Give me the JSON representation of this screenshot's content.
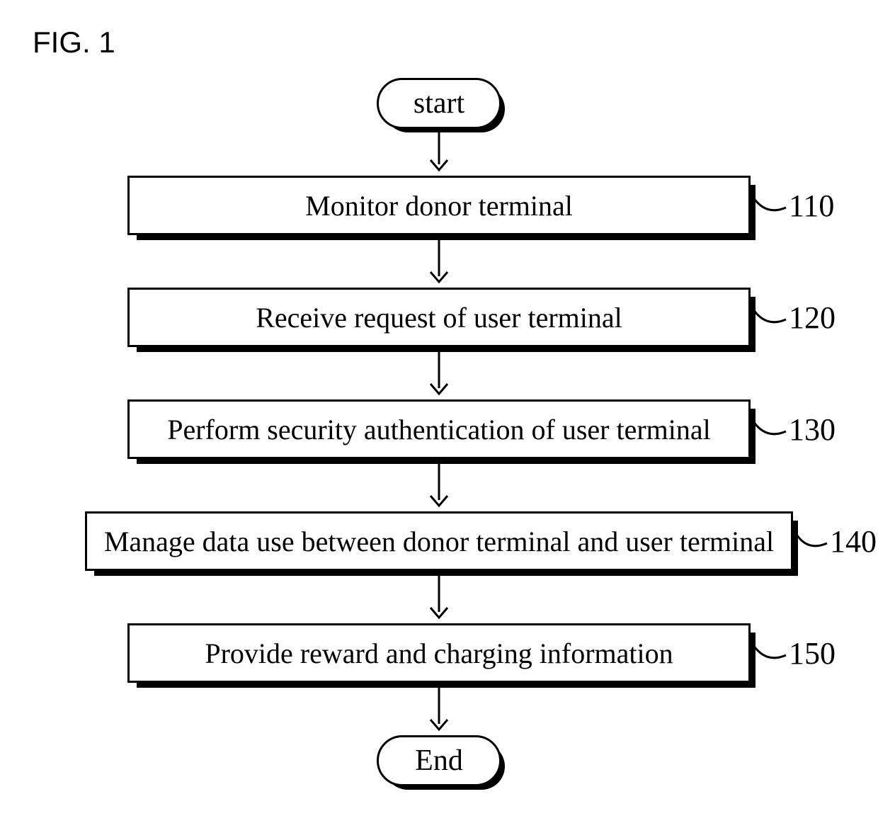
{
  "figure_label": "FIG. 1",
  "flow": {
    "start": "start",
    "end": "End",
    "steps": [
      {
        "label": "Monitor donor terminal",
        "ref": "110"
      },
      {
        "label": "Receive request of user terminal",
        "ref": "120"
      },
      {
        "label": "Perform security authentication of user terminal",
        "ref": "130"
      },
      {
        "label": "Manage data use between donor terminal and user terminal",
        "ref": "140"
      },
      {
        "label": "Provide reward and charging information",
        "ref": "150"
      }
    ]
  }
}
